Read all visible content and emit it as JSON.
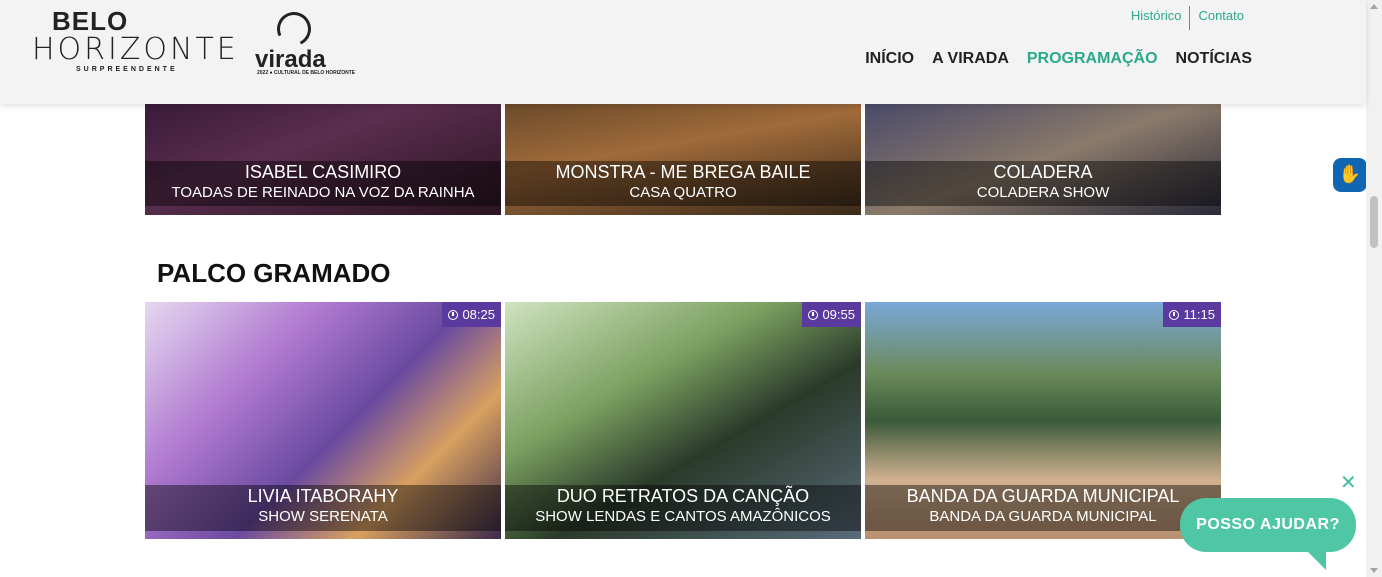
{
  "header": {
    "logo_bh": {
      "line1": "BELO",
      "line2": "HORIZONTE",
      "line3": "SURPREENDENTE"
    },
    "logo_virada": {
      "word": "virada",
      "small": "2022 ● CULTURAL DE BELO HORIZONTE"
    },
    "top_links": [
      "Histórico",
      "Contato"
    ],
    "nav": [
      "INÍCIO",
      "A VIRADA",
      "PROGRAMAÇÃO",
      "NOTÍCIAS"
    ],
    "active_nav": "PROGRAMAÇÃO"
  },
  "upper_row": [
    {
      "title": "ISABEL CASIMIRO",
      "subtitle": "TOADAS DE REINADO NA VOZ DA RAINHA"
    },
    {
      "title": "MONSTRA - ME BREGA BAILE",
      "subtitle": "CASA QUATRO"
    },
    {
      "title": "COLADERA",
      "subtitle": "COLADERA SHOW"
    }
  ],
  "section": {
    "title": "PALCO GRAMADO"
  },
  "lower_row": [
    {
      "time": "08:25",
      "title": "LIVIA ITABORAHY",
      "subtitle": "SHOW SERENATA"
    },
    {
      "time": "09:55",
      "title": "DUO RETRATOS DA CANÇÃO",
      "subtitle": "SHOW LENDAS E CANTOS AMAZÔNICOS"
    },
    {
      "time": "11:15",
      "title": "BANDA DA GUARDA MUNICIPAL",
      "subtitle": "BANDA DA GUARDA MUNICIPAL"
    }
  ],
  "widgets": {
    "help_label": "POSSO AJUDAR?",
    "close": "✕",
    "a11y_icon": "hand-sign-icon"
  },
  "colors": {
    "accent": "#2aa98b",
    "time_badge": "#5b3aa0",
    "help_bubble": "#4fc7a5",
    "a11y": "#1166b3"
  }
}
